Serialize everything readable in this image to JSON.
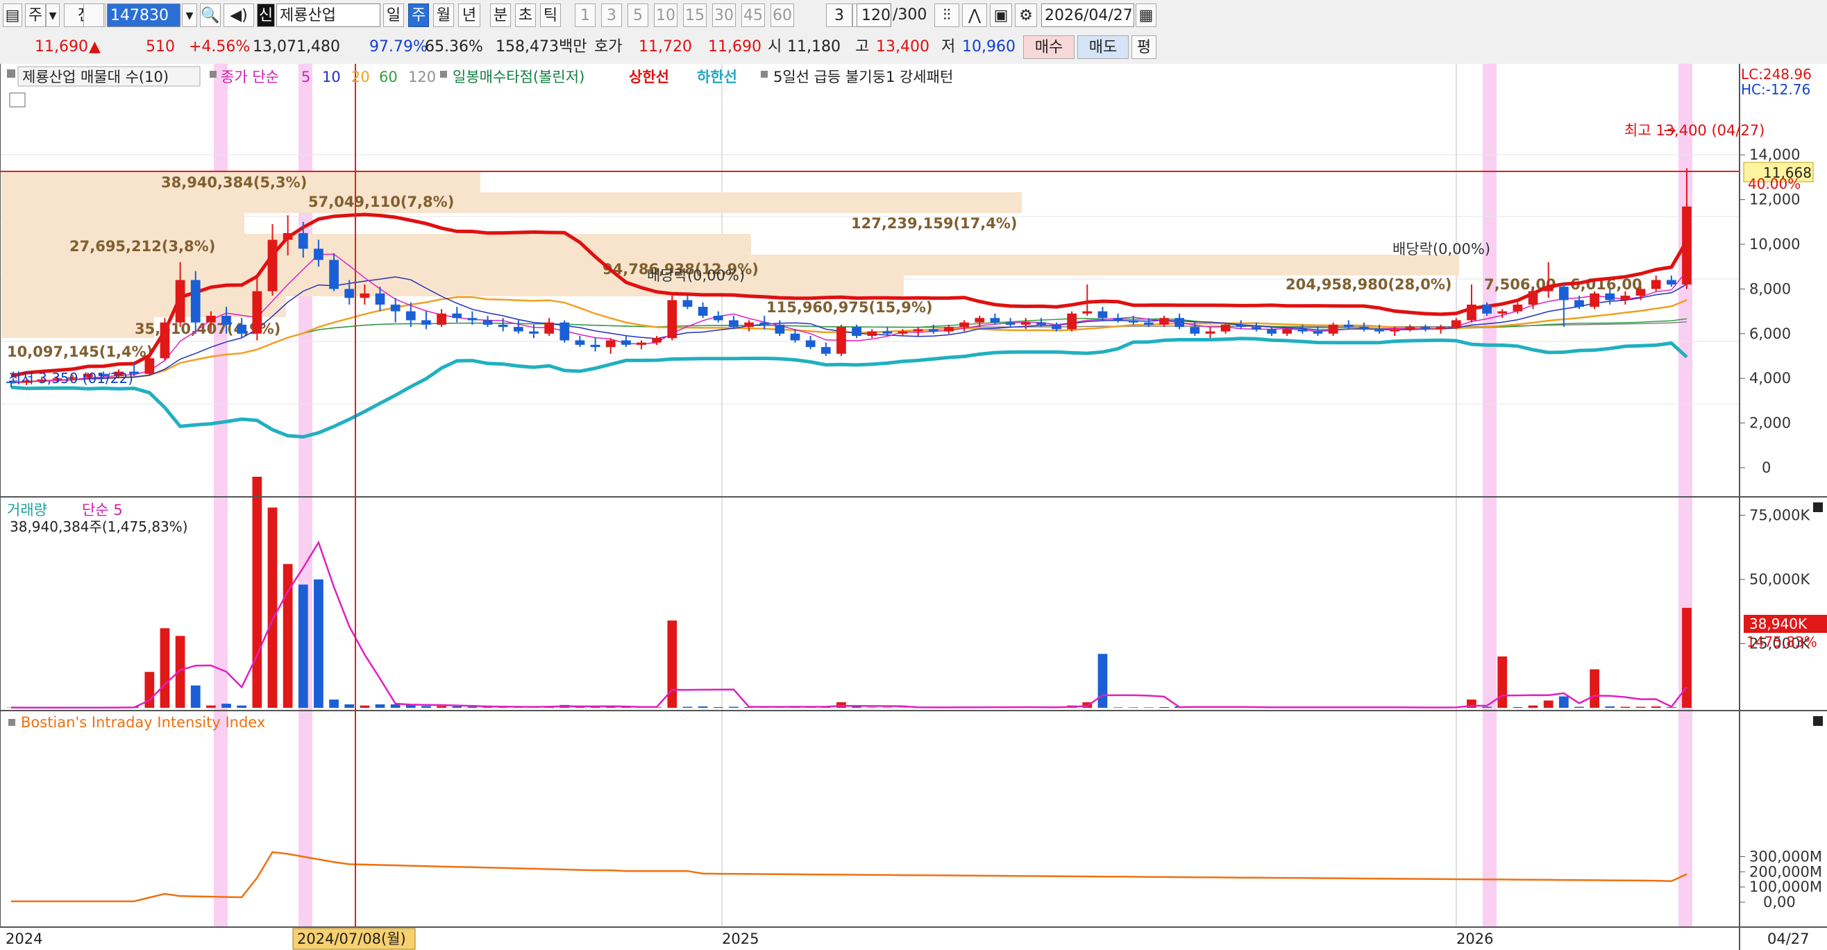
{
  "toolbar": {
    "period_select": "주",
    "jeon_label": "전",
    "stock_code": "147830",
    "credit_badge": "신",
    "stock_name": "제룡산업",
    "periods": [
      "일",
      "주",
      "월",
      "년",
      "분",
      "초",
      "틱"
    ],
    "selected_period": "주",
    "intervals": [
      "1",
      "3",
      "5",
      "10",
      "15",
      "30",
      "45",
      "60"
    ],
    "interval_value": "3",
    "count_display": "120",
    "count_max": "/300",
    "date": "2026/04/27"
  },
  "quote": {
    "price": "11,690",
    "change_arrow": "▲",
    "change": "510",
    "change_pct": "+4.56%",
    "volume": "13,071,480",
    "vol_ratio": "97.79%",
    "turnover": "65.36%",
    "amount": "158,473백만",
    "hoga_label": "호가",
    "ask": "11,720",
    "bid": "11,690",
    "open_label": "시",
    "open": "11,180",
    "high_label": "고",
    "high": "13,400",
    "low_label": "저",
    "low": "10,960",
    "buy_label": "매수",
    "sell_label": "매도",
    "avg_label": "평"
  },
  "price_panel": {
    "legend": {
      "profile": "제룡산업 매물대 수(10)",
      "ma_title": "종가 단순",
      "ma_periods": [
        "5",
        "10",
        "20",
        "60",
        "120"
      ],
      "signal": "일봉매수타점(볼린저)",
      "upper": "상한선",
      "lower": "하한선",
      "pattern": "5일선 급등 불기둥1 강세패턴"
    },
    "lc": "LC:248.96",
    "hc": "HC:-12.76",
    "y_ticks": [
      "14,000",
      "12,000",
      "10,000",
      "8,000",
      "6,000",
      "4,000",
      "2,000",
      "0"
    ],
    "price_tag": "11,668",
    "high_annotation": "최고 13,400 (04/27)",
    "dividend_label": "배당락(0,00%)",
    "low_annotation": "최저 3,350 (01/22)",
    "profile_labels": [
      "38,940,384(5,3%)",
      "57,049,110(7,8%)",
      "127,239,159(17,4%)",
      "27,695,212(3,8%)",
      "94,786,938(12,9%)",
      "204,958,980(28,0%)",
      "115,960,975(15,9%)",
      "35,610,407(4,9%)",
      "10,097,145(1,4%)",
      "7,506,00",
      "6,016,00"
    ]
  },
  "volume_panel": {
    "title": "거래량",
    "ma": "단순 5",
    "value": "38,940,384주(1,475,83%)",
    "y_ticks": [
      "75,000K",
      "50,000K",
      "25,000K"
    ],
    "tag_value": "38,940K",
    "tag_pct": "1475,83%"
  },
  "bii_panel": {
    "title": "Bostian's Intraday Intensity Index",
    "y_ticks": [
      "300,000M",
      "200,000M",
      "100,000M",
      "0,00"
    ]
  },
  "x_axis": {
    "labels": [
      "2024",
      "2025",
      "2026"
    ],
    "cursor_date": "2024/07/08(월)",
    "right_date": "04/27"
  },
  "colors": {
    "up": "#e01818",
    "down": "#1a5fd6",
    "upper_band": "#e01010",
    "lower_band": "#20b0c0",
    "ma5": "#e020c0",
    "ma10": "#2030c0",
    "ma20": "#f0a020",
    "ma60": "#30a040",
    "ma120": "#808080",
    "bii": "#f07010",
    "profile": "#f8e4cc"
  },
  "chart_data": {
    "type": "candlestick",
    "period": "weekly",
    "date_range": [
      "2024",
      "2026/04/27"
    ],
    "notable_points": [
      {
        "label": "최고",
        "value": 13400,
        "date": "04/27"
      },
      {
        "label": "최저",
        "value": 3350,
        "date": "01/22"
      }
    ],
    "ohlc_weekly": [
      [
        3850,
        3900,
        3600,
        3800
      ],
      [
        3800,
        3950,
        3700,
        3900
      ],
      [
        3900,
        4000,
        3800,
        3950
      ],
      [
        3950,
        4100,
        3850,
        4000
      ],
      [
        4000,
        4150,
        3900,
        4050
      ],
      [
        4050,
        4250,
        3950,
        4200
      ],
      [
        4200,
        4300,
        4000,
        4100
      ],
      [
        4100,
        4400,
        4050,
        4300
      ],
      [
        4300,
        4700,
        4100,
        4200
      ],
      [
        4200,
        5000,
        4150,
        4900
      ],
      [
        4900,
        6700,
        4800,
        6500
      ],
      [
        6500,
        9200,
        6300,
        8400
      ],
      [
        8400,
        8800,
        6000,
        6500
      ],
      [
        6500,
        7000,
        6100,
        6800
      ],
      [
        6800,
        7200,
        6000,
        6400
      ],
      [
        6400,
        6700,
        5800,
        6000
      ],
      [
        6000,
        8500,
        5700,
        7900
      ],
      [
        7900,
        10900,
        7700,
        10200
      ],
      [
        10200,
        11300,
        9500,
        10500
      ],
      [
        10500,
        11000,
        9400,
        9800
      ],
      [
        9800,
        10200,
        9000,
        9300
      ],
      [
        9300,
        9600,
        7900,
        8000
      ],
      [
        8000,
        8400,
        7300,
        7600
      ],
      [
        7600,
        8200,
        7300,
        7800
      ],
      [
        7800,
        8100,
        7000,
        7300
      ],
      [
        7300,
        7600,
        6500,
        7000
      ],
      [
        7000,
        7400,
        6300,
        6600
      ],
      [
        6600,
        7000,
        6200,
        6400
      ],
      [
        6400,
        7100,
        6300,
        6900
      ],
      [
        6900,
        7200,
        6500,
        6700
      ],
      [
        6700,
        7000,
        6400,
        6600
      ],
      [
        6600,
        6800,
        6300,
        6400
      ],
      [
        6400,
        6700,
        6100,
        6300
      ],
      [
        6300,
        6600,
        6000,
        6100
      ],
      [
        6100,
        6400,
        5800,
        6000
      ],
      [
        6000,
        6700,
        5900,
        6500
      ],
      [
        6500,
        6600,
        5600,
        5700
      ],
      [
        5700,
        5900,
        5400,
        5500
      ],
      [
        5500,
        5800,
        5200,
        5400
      ],
      [
        5400,
        5800,
        5100,
        5700
      ],
      [
        5700,
        5900,
        5400,
        5500
      ],
      [
        5500,
        5700,
        5300,
        5600
      ],
      [
        5600,
        5900,
        5500,
        5800
      ],
      [
        5800,
        7700,
        5700,
        7500
      ],
      [
        7500,
        7700,
        7100,
        7200
      ],
      [
        7200,
        7400,
        6700,
        6800
      ],
      [
        6800,
        7000,
        6500,
        6600
      ],
      [
        6600,
        6800,
        6200,
        6300
      ],
      [
        6300,
        6600,
        6100,
        6500
      ],
      [
        6500,
        6800,
        6200,
        6400
      ],
      [
        6400,
        6600,
        5900,
        6000
      ],
      [
        6000,
        6200,
        5600,
        5700
      ],
      [
        5700,
        5900,
        5300,
        5400
      ],
      [
        5400,
        5600,
        5000,
        5100
      ],
      [
        5100,
        6400,
        5000,
        6300
      ],
      [
        6300,
        6400,
        5800,
        5900
      ],
      [
        5900,
        6200,
        5800,
        6100
      ],
      [
        6100,
        6300,
        5900,
        6000
      ],
      [
        6000,
        6200,
        5900,
        6100
      ],
      [
        6100,
        6300,
        5900,
        6200
      ],
      [
        6200,
        6400,
        6000,
        6100
      ],
      [
        6100,
        6400,
        6000,
        6300
      ],
      [
        6300,
        6600,
        6100,
        6500
      ],
      [
        6500,
        6800,
        6300,
        6700
      ],
      [
        6700,
        6900,
        6400,
        6500
      ],
      [
        6500,
        6700,
        6300,
        6400
      ],
      [
        6400,
        6700,
        6200,
        6500
      ],
      [
        6500,
        6700,
        6300,
        6400
      ],
      [
        6400,
        6500,
        6100,
        6200
      ],
      [
        6200,
        7000,
        6100,
        6900
      ],
      [
        6900,
        8200,
        6800,
        7000
      ],
      [
        7000,
        7200,
        6600,
        6700
      ],
      [
        6700,
        6900,
        6500,
        6600
      ],
      [
        6600,
        6800,
        6400,
        6500
      ],
      [
        6500,
        6700,
        6300,
        6400
      ],
      [
        6400,
        6800,
        6300,
        6700
      ],
      [
        6700,
        6900,
        6200,
        6300
      ],
      [
        6300,
        6500,
        5900,
        6000
      ],
      [
        6000,
        6300,
        5800,
        6100
      ],
      [
        6100,
        6500,
        6000,
        6400
      ],
      [
        6400,
        6600,
        6200,
        6300
      ],
      [
        6300,
        6500,
        6100,
        6200
      ],
      [
        6200,
        6300,
        5900,
        6000
      ],
      [
        6000,
        6300,
        5900,
        6200
      ],
      [
        6200,
        6400,
        6000,
        6100
      ],
      [
        6100,
        6300,
        5900,
        6000
      ],
      [
        6000,
        6500,
        5900,
        6400
      ],
      [
        6400,
        6600,
        6200,
        6300
      ],
      [
        6300,
        6500,
        6100,
        6200
      ],
      [
        6200,
        6400,
        6000,
        6100
      ],
      [
        6100,
        6300,
        5900,
        6200
      ],
      [
        6200,
        6400,
        6100,
        6300
      ],
      [
        6300,
        6400,
        6100,
        6200
      ],
      [
        6200,
        6400,
        6000,
        6300
      ],
      [
        6300,
        6700,
        6200,
        6600
      ],
      [
        6600,
        8200,
        6500,
        7300
      ],
      [
        7300,
        7400,
        6800,
        6900
      ],
      [
        6900,
        7100,
        6700,
        7000
      ],
      [
        7000,
        7400,
        6900,
        7300
      ],
      [
        7300,
        8000,
        7100,
        7900
      ],
      [
        7900,
        9200,
        7600,
        8100
      ],
      [
        8100,
        8300,
        6300,
        7500
      ],
      [
        7500,
        7700,
        7100,
        7200
      ],
      [
        7200,
        7900,
        7100,
        7800
      ],
      [
        7800,
        8000,
        7300,
        7500
      ],
      [
        7500,
        7900,
        7300,
        7700
      ],
      [
        7700,
        8100,
        7500,
        8000
      ],
      [
        8000,
        8600,
        7900,
        8400
      ],
      [
        8400,
        8600,
        8100,
        8200
      ],
      [
        8200,
        13400,
        8000,
        11690
      ]
    ]
  }
}
